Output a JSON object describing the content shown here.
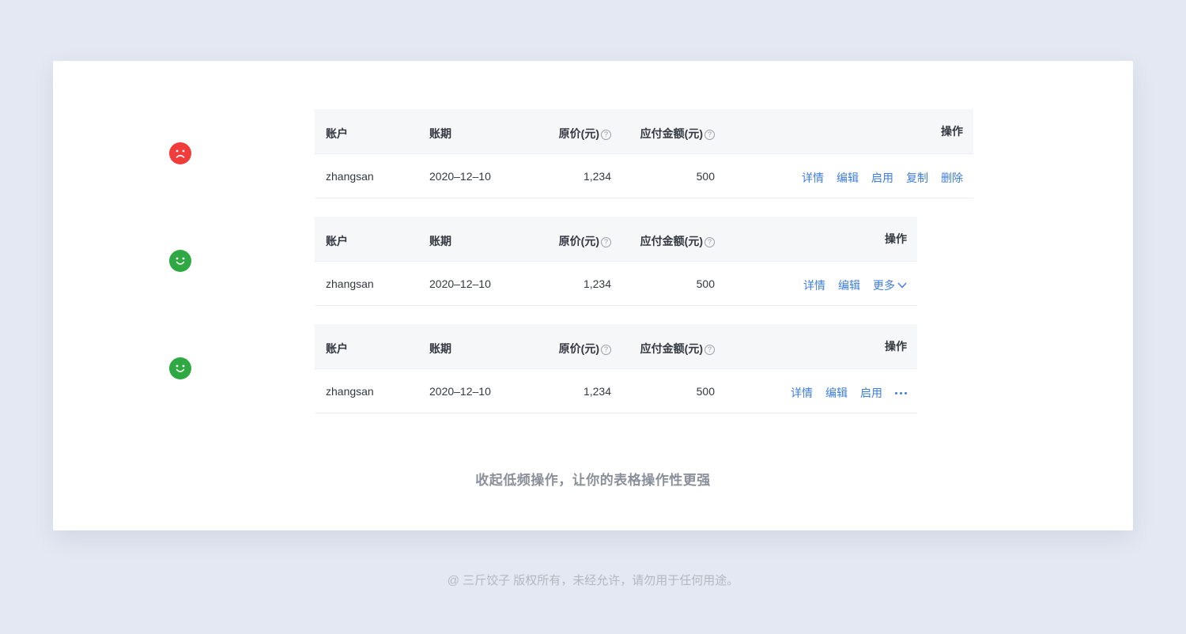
{
  "colors": {
    "bad": "#f23b3b",
    "good": "#2ea843",
    "link": "#3d7ce0"
  },
  "faces": [
    {
      "icon": "sad-face-icon"
    },
    {
      "icon": "happy-face-icon"
    },
    {
      "icon": "happy-face-icon"
    }
  ],
  "tables": [
    {
      "headers": {
        "account": "账户",
        "period": "账期",
        "price": "原价(元)",
        "payable": "应付金额(元)",
        "actions": "操作"
      },
      "row": {
        "account": "zhangsan",
        "period": "2020–12–10",
        "price": "1,234",
        "payable": "500"
      },
      "actions": [
        "详情",
        "编辑",
        "启用",
        "复制",
        "删除"
      ]
    },
    {
      "headers": {
        "account": "账户",
        "period": "账期",
        "price": "原价(元)",
        "payable": "应付金额(元)",
        "actions": "操作"
      },
      "row": {
        "account": "zhangsan",
        "period": "2020–12–10",
        "price": "1,234",
        "payable": "500"
      },
      "actions": [
        "详情",
        "编辑"
      ],
      "more_label": "更多"
    },
    {
      "headers": {
        "account": "账户",
        "period": "账期",
        "price": "原价(元)",
        "payable": "应付金额(元)",
        "actions": "操作"
      },
      "row": {
        "account": "zhangsan",
        "period": "2020–12–10",
        "price": "1,234",
        "payable": "500"
      },
      "actions": [
        "详情",
        "编辑",
        "启用"
      ],
      "more_icon": "ellipsis-icon"
    }
  ],
  "help_glyph": "?",
  "caption": "收起低频操作，让你的表格操作性更强",
  "footer": "@ 三斤饺子   版权所有，未经允许，请勿用于任何用途。"
}
